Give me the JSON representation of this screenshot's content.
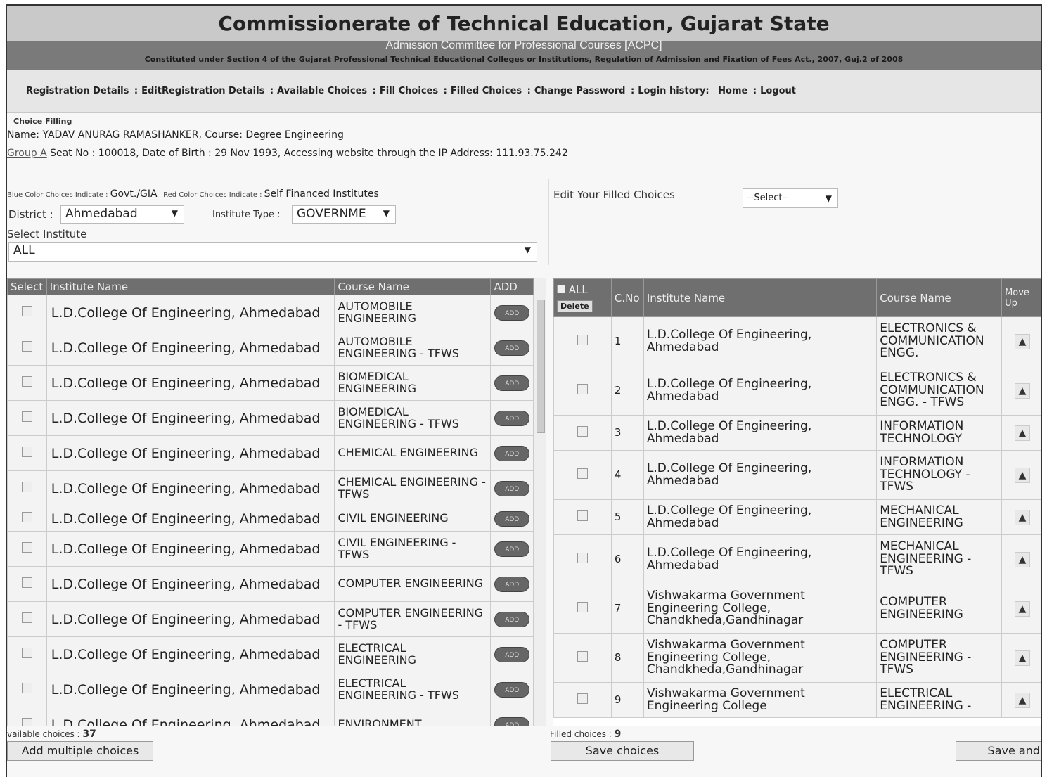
{
  "header": {
    "title": "Commissionerate of Technical Education, Gujarat State",
    "subtitle": "Admission Committee for Professional Courses [ACPC]",
    "constituted": "Constituted under Section 4 of the Gujarat Professional Technical Educational Colleges or Institutions, Regulation of Admission and Fixation of Fees Act., 2007, Guj.2 of 2008"
  },
  "nav": {
    "items": [
      "Registration Details",
      "EditRegistration Details",
      "Available Choices",
      "Fill Choices",
      "Filled Choices",
      "Change Password",
      "Login history:",
      "Home",
      "Logout"
    ]
  },
  "info": {
    "section_title": "Choice Filling",
    "name_label": "Name: ",
    "name": "YADAV ANURAG RAMASHANKER",
    "course_label": ", Course: ",
    "course": "Degree Engineering",
    "group": "Group A",
    "seat_text": " Seat No : 100018,  Date of Birth : 29 Nov 1993,  Accessing website through the IP Address: 111.93.75.242"
  },
  "filters": {
    "blue_small": "Blue Color Choices Indicate : ",
    "blue_value": "Govt./GIA",
    "red_small": "Red Color Choices Indicate : ",
    "red_value": "Self Financed Institutes",
    "district_label": "District : ",
    "district_value": "Ahmedabad",
    "type_label": "Institute Type : ",
    "type_value": "GOVERNME",
    "select_institute_label": "Select Institute",
    "institute_value": "ALL",
    "edit_label": "Edit Your Filled Choices",
    "edit_value": "--Select--"
  },
  "left_table": {
    "headers": [
      "Select",
      "Institute Name",
      "Course Name",
      "ADD"
    ],
    "add_label": "ADD",
    "rows": [
      {
        "inst": "L.D.College Of Engineering, Ahmedabad",
        "course": "AUTOMOBILE ENGINEERING"
      },
      {
        "inst": "L.D.College Of Engineering, Ahmedabad",
        "course": "AUTOMOBILE ENGINEERING - TFWS"
      },
      {
        "inst": "L.D.College Of Engineering, Ahmedabad",
        "course": "BIOMEDICAL ENGINEERING"
      },
      {
        "inst": "L.D.College Of Engineering, Ahmedabad",
        "course": "BIOMEDICAL ENGINEERING - TFWS"
      },
      {
        "inst": "L.D.College Of Engineering, Ahmedabad",
        "course": "CHEMICAL ENGINEERING"
      },
      {
        "inst": "L.D.College Of Engineering, Ahmedabad",
        "course": "CHEMICAL ENGINEERING - TFWS"
      },
      {
        "inst": "L.D.College Of Engineering, Ahmedabad",
        "course": "CIVIL ENGINEERING"
      },
      {
        "inst": "L.D.College Of Engineering, Ahmedabad",
        "course": "CIVIL ENGINEERING - TFWS"
      },
      {
        "inst": "L.D.College Of Engineering, Ahmedabad",
        "course": "COMPUTER ENGINEERING"
      },
      {
        "inst": "L.D.College Of Engineering, Ahmedabad",
        "course": "COMPUTER ENGINEERING - TFWS"
      },
      {
        "inst": "L.D.College Of Engineering, Ahmedabad",
        "course": "ELECTRICAL ENGINEERING"
      },
      {
        "inst": "L.D.College Of Engineering, Ahmedabad",
        "course": "ELECTRICAL ENGINEERING - TFWS"
      },
      {
        "inst": "L.D.College Of Engineering, Ahmedabad",
        "course": "ENVIRONMENT"
      }
    ]
  },
  "right_table": {
    "all_label": "ALL",
    "delete_label": "Delete",
    "headers": [
      "C.No",
      "Institute Name",
      "Course Name",
      "Move Up"
    ],
    "rows": [
      {
        "no": "1",
        "inst": "L.D.College Of Engineering, Ahmedabad",
        "course": "ELECTRONICS & COMMUNICATION ENGG."
      },
      {
        "no": "2",
        "inst": "L.D.College Of Engineering, Ahmedabad",
        "course": "ELECTRONICS & COMMUNICATION ENGG. - TFWS"
      },
      {
        "no": "3",
        "inst": "L.D.College Of Engineering, Ahmedabad",
        "course": "INFORMATION TECHNOLOGY"
      },
      {
        "no": "4",
        "inst": "L.D.College Of Engineering, Ahmedabad",
        "course": "INFORMATION TECHNOLOGY - TFWS"
      },
      {
        "no": "5",
        "inst": "L.D.College Of Engineering, Ahmedabad",
        "course": "MECHANICAL ENGINEERING"
      },
      {
        "no": "6",
        "inst": "L.D.College Of Engineering, Ahmedabad",
        "course": "MECHANICAL ENGINEERING - TFWS"
      },
      {
        "no": "7",
        "inst": "Vishwakarma Government Engineering College, Chandkheda,Gandhinagar",
        "course": "COMPUTER ENGINEERING"
      },
      {
        "no": "8",
        "inst": "Vishwakarma Government Engineering College, Chandkheda,Gandhinagar",
        "course": "COMPUTER ENGINEERING - TFWS"
      },
      {
        "no": "9",
        "inst": "Vishwakarma Government Engineering College",
        "course": "ELECTRICAL ENGINEERING -"
      }
    ]
  },
  "footer": {
    "available_label": "vailable choices : ",
    "available_count": "37",
    "filled_label": "Filled choices : ",
    "filled_count": "9",
    "add_multiple": "Add multiple choices",
    "save_choices": "Save choices",
    "save_and": "Save and"
  },
  "icons": {
    "dropdown": "chevron-down-icon",
    "move_up": "arrow-up-icon",
    "checkbox": "checkbox-icon"
  }
}
